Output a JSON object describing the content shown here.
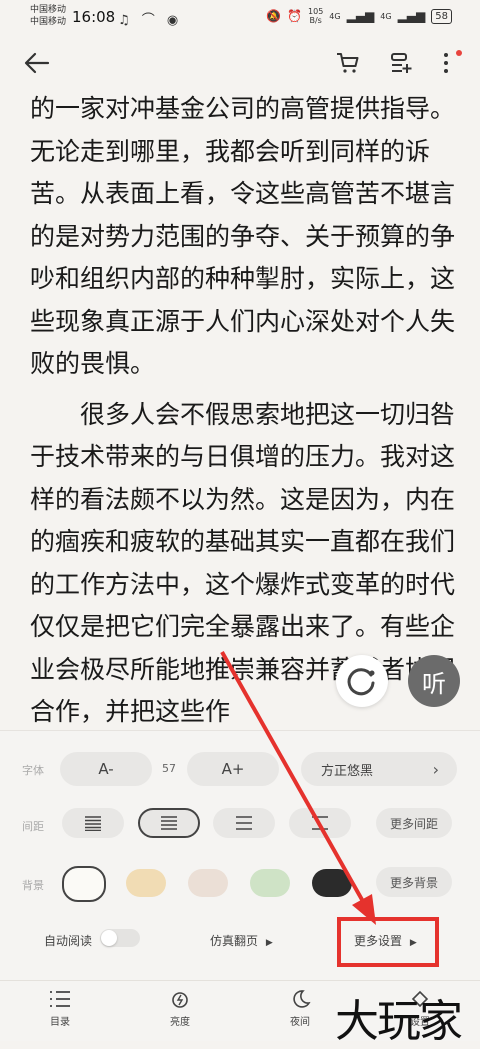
{
  "status": {
    "carrier1": "中国移动",
    "carrier2": "中国移动",
    "time": "16:08",
    "net_speed_value": "105",
    "net_speed_unit": "B/s",
    "signal1": "4G",
    "signal2": "4G",
    "battery": "58"
  },
  "topbar": {
    "back_icon": "arrow-left-icon",
    "cart_icon": "cart-icon",
    "add_shelf_icon": "add-shelf-icon",
    "more_icon": "more-vertical-icon"
  },
  "reader": {
    "paragraph1": "的一家对冲基金公司的高管提供指导。无论走到哪里，我都会听到同样的诉苦。从表面上看，令这些高管苦不堪言的是对势力范围的争夺、关于预算的争吵和组织内部的种种掣肘，实际上，这些现象真正源于人们内心深处对个人失败的畏惧。",
    "paragraph2": "很多人会不假思索地把这一切归咎于技术带来的与日俱增的压力。我对这样的看法颇不以为然。这是因为，内在的痼疾和疲软的基础其实一直都在我们的工作方法中，这个爆炸式变革的时代仅仅是把它们完全暴露出来了。有些企业会极尽所能地推崇兼容并蓄或者协同合作，并把这些作",
    "listen_label": "听"
  },
  "settings": {
    "font_label": "字体",
    "font_decrease": "A-",
    "font_size": "57",
    "font_increase": "A+",
    "font_name": "方正悠黑",
    "spacing_label": "间距",
    "more_spacing": "更多间距",
    "background_label": "背景",
    "more_background": "更多背景",
    "auto_read": "自动阅读",
    "page_turn": "仿真翻页",
    "more_settings": "更多设置",
    "swatches": [
      "#fbfaf6",
      "#f1dcb4",
      "#ebdfd6",
      "#cfe3c6",
      "#2b2b2b"
    ]
  },
  "bottombar": {
    "toc": "目录",
    "brightness": "亮度",
    "night": "夜间",
    "settings": "设置"
  },
  "watermark": "大玩家",
  "colors": {
    "annotation_red": "#e5322d",
    "panel_bg": "#f5f4f2"
  }
}
